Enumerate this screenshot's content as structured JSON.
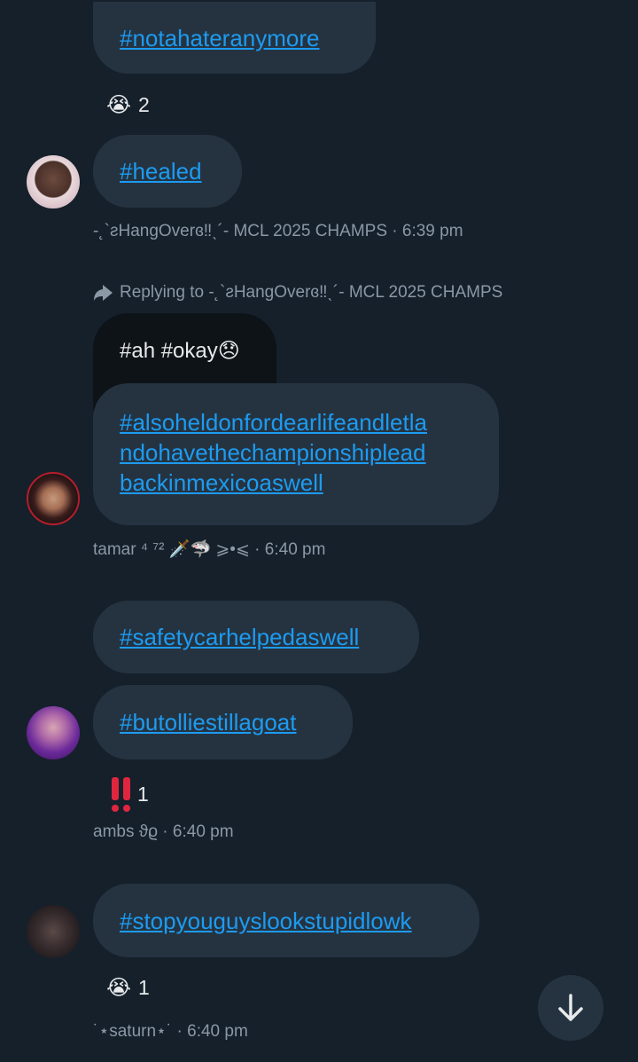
{
  "messages": [
    {
      "id": "m1",
      "tag": "#notahateranymore",
      "reaction_emoji": "😭",
      "reaction_count": "2"
    },
    {
      "id": "m2",
      "tag": "#healed",
      "author": "-˛`ƨHangOverɞ‼︎ˎ´- MCL 2025 CHAMPS",
      "time": "6:39 pm"
    },
    {
      "id": "m3",
      "reply_prefix": "Replying to",
      "reply_target": "-˛`ƨHangOverɞ‼︎ˎ´- MCL 2025 CHAMPS",
      "quoted": "#ah #okay😞",
      "tag_lines": [
        "#alsoheldonfordearlifeandletla",
        "ndohavethechampionshiplead",
        "backinmexicoaswell"
      ],
      "author": "tamar ⁴ ⁷²",
      "author_emoji": "🗡️🦈",
      "author_suffix": "⩾•⩽",
      "time": "6:40 pm"
    },
    {
      "id": "m4",
      "tag": "#safetycarhelpedaswell"
    },
    {
      "id": "m5",
      "tag": "#butolliestillagoat",
      "reaction_emoji": "‼️",
      "reaction_count": "1",
      "author": "ambs ϑϱ",
      "time": "6:40 pm"
    },
    {
      "id": "m6",
      "tag": "#stopyouguyslookstupidlowk",
      "reaction_emoji": "😭",
      "reaction_count": "1",
      "author": "˙⋆saturn⋆˙",
      "time": "6:40 pm"
    }
  ],
  "separator": " · ",
  "scroll_down_icon": "arrow-down-icon",
  "colors": {
    "background": "#15202b",
    "bubble": "#253341",
    "quoted_bubble": "#0e1318",
    "link": "#1d9bf0",
    "meta": "#8b98a5"
  }
}
